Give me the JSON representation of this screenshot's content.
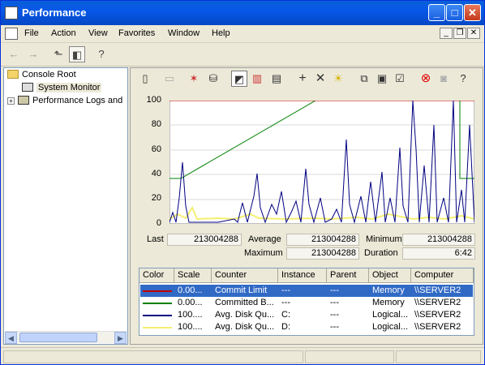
{
  "window": {
    "title": "Performance"
  },
  "menu": {
    "items": [
      "File",
      "Action",
      "View",
      "Favorites",
      "Window",
      "Help"
    ]
  },
  "tree": {
    "root": "Console Root",
    "items": [
      {
        "label": "System Monitor",
        "selected": true
      },
      {
        "label": "Performance Logs and",
        "expandable": true
      }
    ]
  },
  "graph": {
    "y_ticks": [
      "100",
      "80",
      "60",
      "40",
      "20",
      "0"
    ]
  },
  "stats": {
    "last_label": "Last",
    "last_value": "213004288",
    "average_label": "Average",
    "average_value": "213004288",
    "minimum_label": "Minimum",
    "minimum_value": "213004288",
    "maximum_label": "Maximum",
    "maximum_value": "213004288",
    "duration_label": "Duration",
    "duration_value": "6:42"
  },
  "legend": {
    "headers": [
      "Color",
      "Scale",
      "Counter",
      "Instance",
      "Parent",
      "Object",
      "Computer"
    ],
    "rows": [
      {
        "color": "#c00000",
        "scale": "0.00...",
        "counter": "Commit Limit",
        "instance": "---",
        "parent": "---",
        "object": "Memory",
        "computer": "\\\\SERVER2",
        "selected": true
      },
      {
        "color": "#008000",
        "scale": "0.00...",
        "counter": "Committed B...",
        "instance": "---",
        "parent": "---",
        "object": "Memory",
        "computer": "\\\\SERVER2"
      },
      {
        "color": "#000080",
        "scale": "100....",
        "counter": "Avg. Disk Qu...",
        "instance": "C:",
        "parent": "---",
        "object": "Logical...",
        "computer": "\\\\SERVER2"
      },
      {
        "color": "#f5ef70",
        "scale": "100....",
        "counter": "Avg. Disk Qu...",
        "instance": "D:",
        "parent": "---",
        "object": "Logical...",
        "computer": "\\\\SERVER2"
      }
    ]
  },
  "icons": {
    "toolbar": [
      "back-icon",
      "forward-icon",
      "up-folder-icon",
      "show-hide-tree-icon",
      "help-icon"
    ],
    "right_toolbar": [
      "new-counter-set-icon",
      "clear-display-icon",
      "view-current-activity-icon",
      "view-log-data-icon",
      "view-graph-icon",
      "view-histogram-icon",
      "view-report-icon",
      "add-counter-icon",
      "delete-counter-icon",
      "highlight-icon",
      "copy-properties-icon",
      "paste-counter-list-icon",
      "properties-icon",
      "freeze-display-icon",
      "update-data-icon",
      "help-icon"
    ]
  }
}
